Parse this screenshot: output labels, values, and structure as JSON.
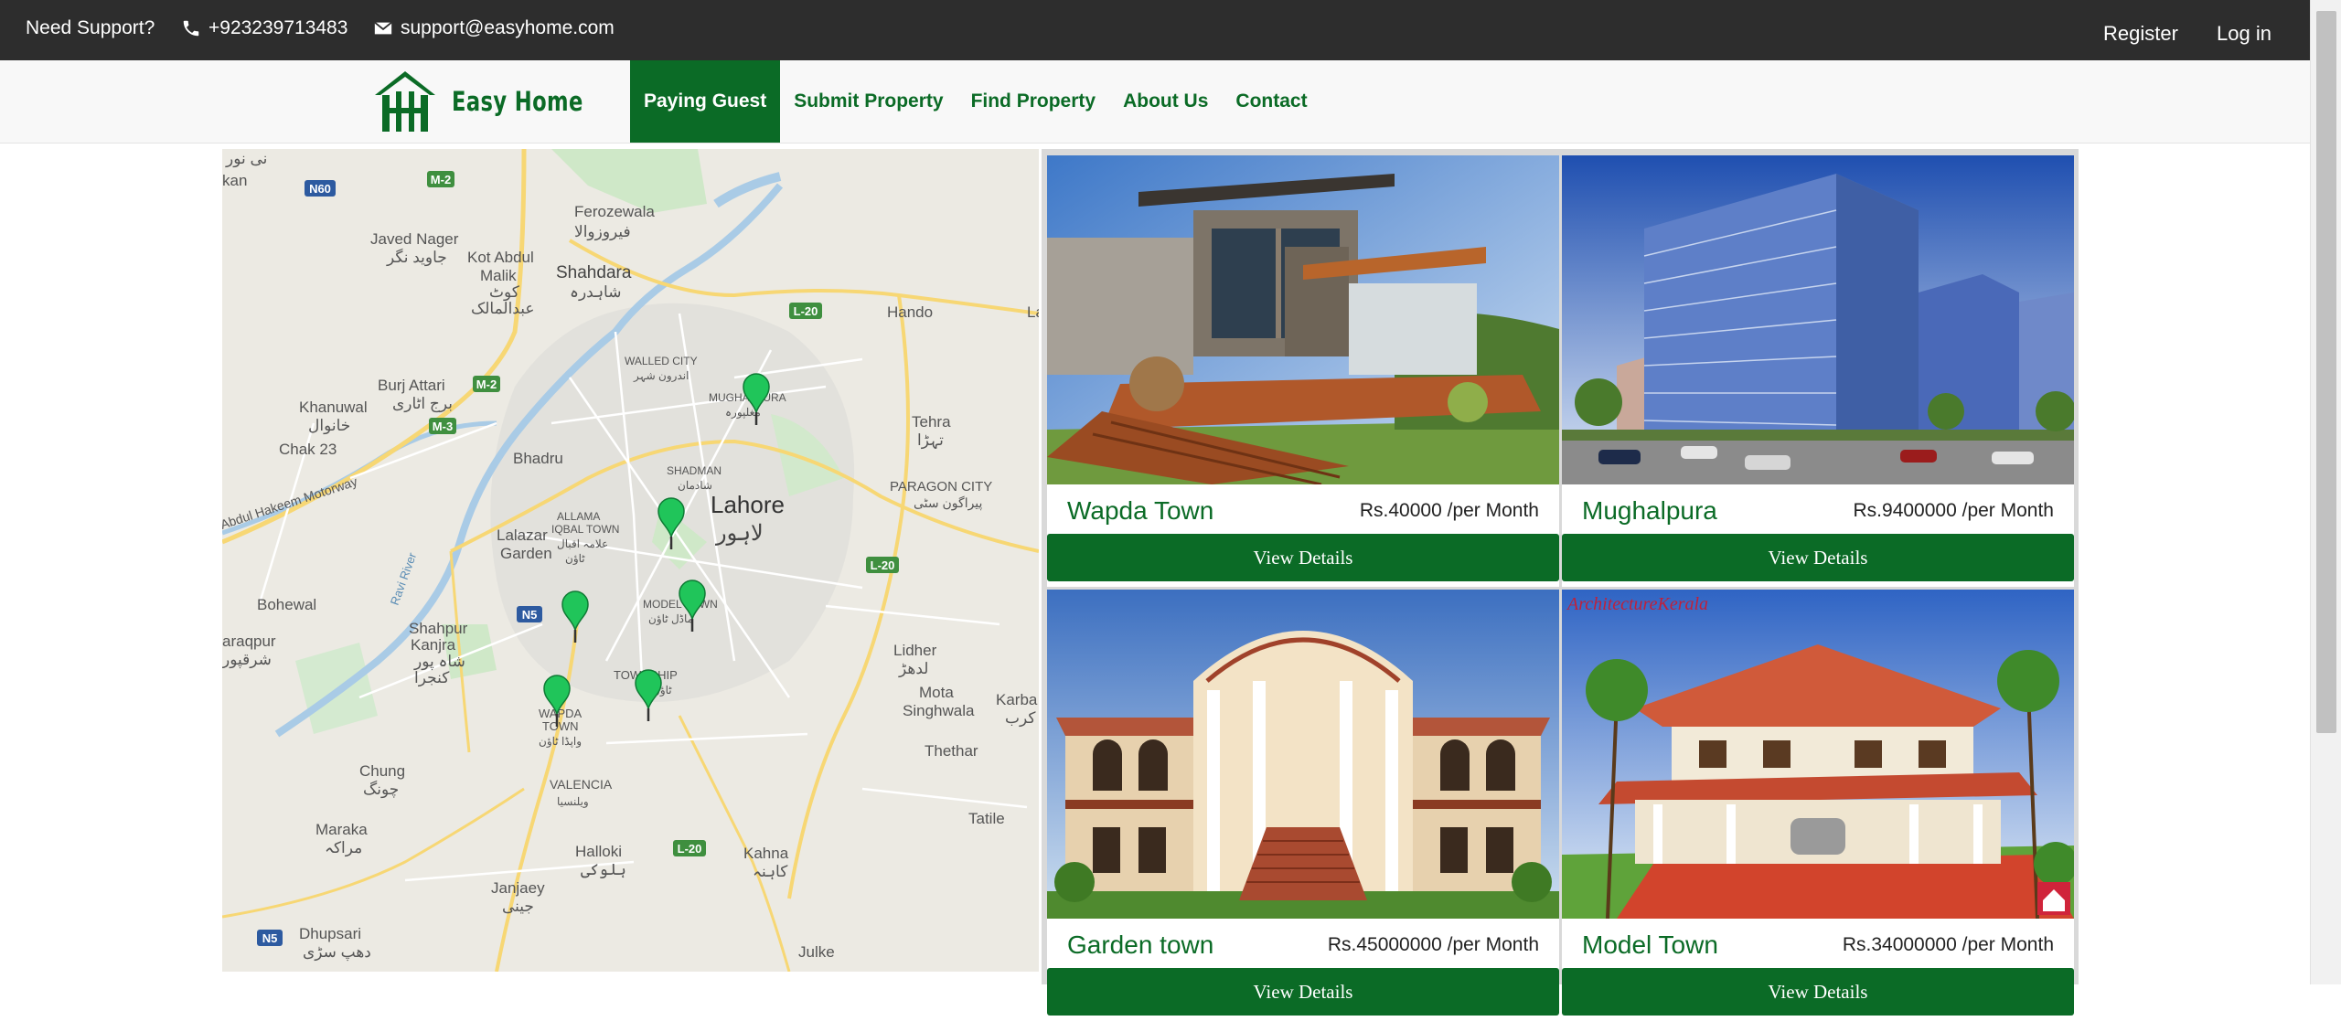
{
  "topbar": {
    "support_label": "Need Support?",
    "phone": "+923239713483",
    "email": "support@easyhome.com",
    "register": "Register",
    "login": "Log in"
  },
  "nav": {
    "logo_text": "Easy Home",
    "items": [
      {
        "label": "Paying Guest",
        "active": true
      },
      {
        "label": "Submit Property",
        "active": false
      },
      {
        "label": "Find Property",
        "active": false
      },
      {
        "label": "About Us",
        "active": false
      },
      {
        "label": "Contact",
        "active": false
      }
    ]
  },
  "map": {
    "labels": {
      "ferozewala": "Ferozewala",
      "ferozewala_ur": "فیروزوالا",
      "javed_nagar": "Javed Nager",
      "javed_nagar_ur": "جاوید نگر",
      "kot_abdul_malik": "Kot Abdul",
      "kot_abdul_malik2": "Malik",
      "kot_abdul_malik_ur": "کوٹ",
      "kot_abdul_malik_ur2": "عبدالمالک",
      "shahdara": "Shahdara",
      "shahdara_ur": "شاہدرہ",
      "hando": "Hando",
      "walled_city": "WALLED CITY",
      "walled_city_ur": "اندرون شہر",
      "mughalpura": "MUGHALPURA",
      "mughalpura_ur": "مغلپورہ",
      "burj_attari": "Burj Attari",
      "burj_attari_ur": "برج اٹاری",
      "khanuwal": "Khanuwal",
      "khanuwal_ur": "خانوال",
      "chak23": "Chak 23",
      "tehra": "Tehra",
      "tehra_ur": "تہڑا",
      "bhadru": "Bhadru",
      "shadman": "SHADMAN",
      "shadman_ur": "شادمان",
      "paragon": "PARAGON CITY",
      "paragon_ur": "پیراگون سٹی",
      "motorway": "Abdul Hakeem Motorway",
      "lahore": "Lahore",
      "lahore_ur": "لاہور",
      "allama": "ALLAMA",
      "iqbal_town": "IQBAL TOWN",
      "allama_ur": "علامہ اقبال",
      "allama_ur2": "ٹاؤن",
      "lalazar": "Lalazar",
      "garden": "Garden",
      "ravi_river": "Ravi River",
      "bohewal": "Bohewal",
      "model_town": "MODEL TOWN",
      "model_town_ur": "ماڈل ٹاؤن",
      "shahpur": "Shahpur",
      "kanjra": "Kanjra",
      "shahpur_ur": "شاہ پور",
      "kanjra_ur": "کنجرا",
      "araqpur": "araqpur",
      "araqpur_ur": "شرقپور",
      "lidher": "Lidher",
      "lidher_ur": "لدھڑ",
      "township": "TOWNSHIP",
      "township_ur": "ٹاؤن",
      "mota_singhwala": "Mota",
      "mota_singhwala2": "Singhwala",
      "karba": "Karba",
      "karba_ur": "کرب",
      "wapda": "WAPDA",
      "wapda_town": "TOWN",
      "wapda_ur": "واپڈا ٹاؤن",
      "chung": "Chung",
      "chung_ur": "چونگ",
      "thethar": "Thethar",
      "valencia": "VALENCIA",
      "valencia_ur": "ویلنسیا",
      "tatile": "Tatile",
      "maraka": "Maraka",
      "maraka_ur": "مراکہ",
      "halloki": "Halloki",
      "halloki_ur": "ہلوکی",
      "kahna": "Kahna",
      "kahna_ur": "کاہنہ",
      "janjeey": "Janjaey",
      "janjeey_ur": "جینی",
      "dhupsari": "Dhupsari",
      "dhupsari_ur": "دھپ سڑی",
      "julke": "Julke",
      "top_left_ur": "نی نور",
      "kan": "kan",
      "la": "La"
    },
    "road_shields": [
      "M-2",
      "M-2",
      "M-3",
      "N60",
      "L-20",
      "L-20",
      "L-20",
      "N5",
      "N5"
    ]
  },
  "listings": [
    {
      "name": "Wapda Town",
      "price": "Rs.40000 /per Month",
      "button": "View Details"
    },
    {
      "name": "Mughalpura",
      "price": "Rs.9400000 /per Month",
      "button": "View Details"
    },
    {
      "name": "Garden town",
      "price": "Rs.45000000 /per Month",
      "button": "View Details"
    },
    {
      "name": "Model Town",
      "price": "Rs.34000000 /per Month",
      "button": "View Details"
    }
  ],
  "watermark": "ArchitectureKerala",
  "colors": {
    "brand_green": "#0b6b26",
    "topbar": "#2d2d2d",
    "pin": "#20c55a"
  }
}
